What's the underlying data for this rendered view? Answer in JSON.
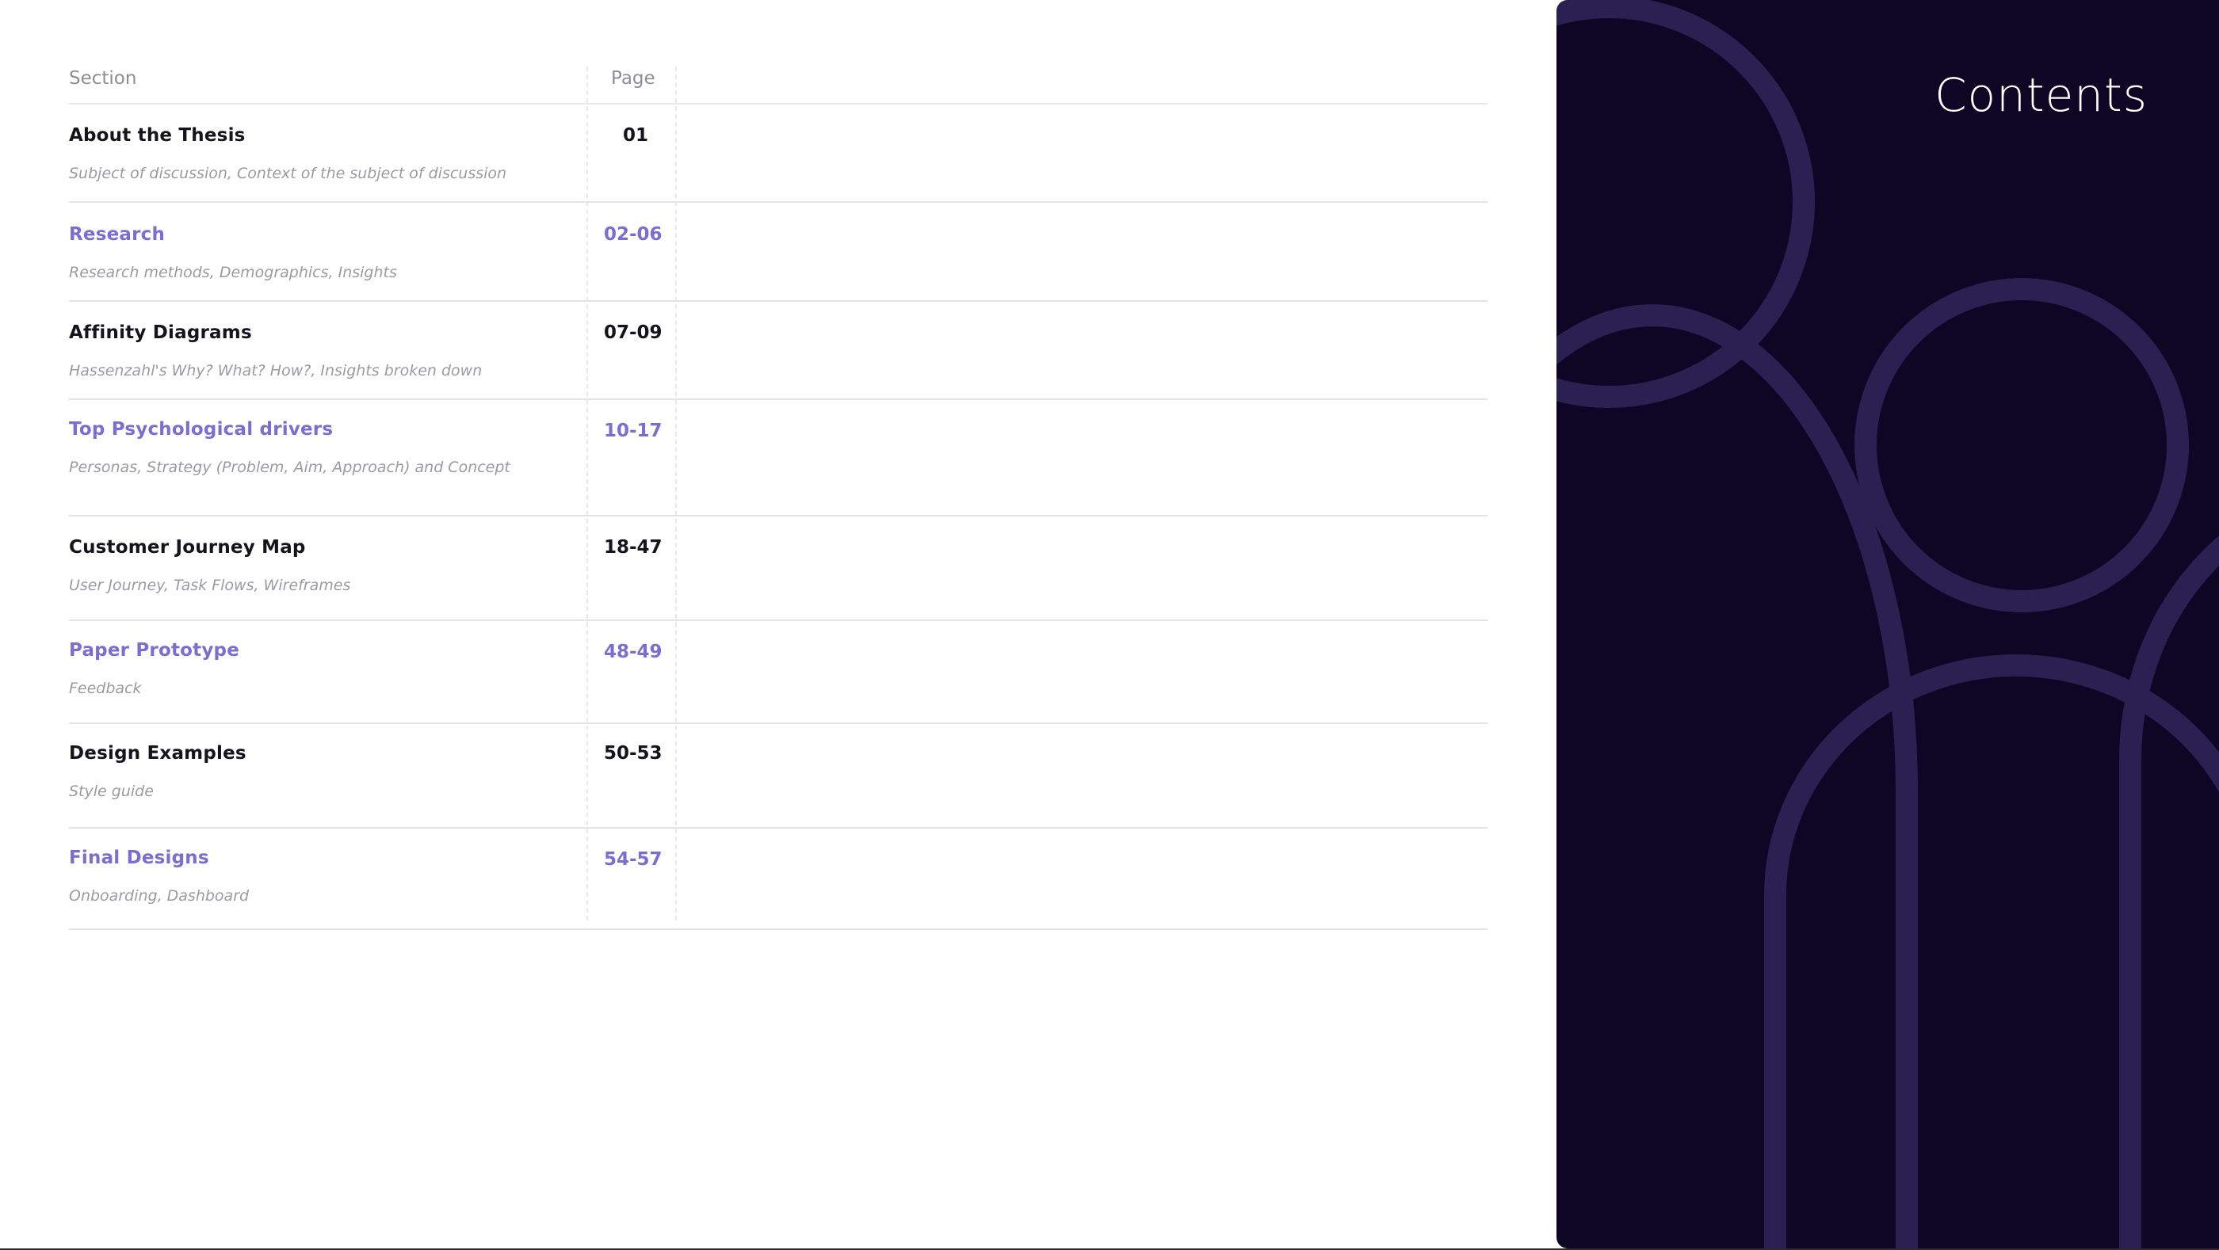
{
  "panel": {
    "title": "Contents"
  },
  "toc": {
    "headers": {
      "section": "Section",
      "page": "Page"
    },
    "rows": [
      {
        "title": "About the Thesis",
        "subtitle": "Subject of discussion, Context of the subject of discussion",
        "pages": "01"
      },
      {
        "title": "Research",
        "subtitle": "Research methods, Demographics, Insights",
        "pages": "02-06"
      },
      {
        "title": "Affinity Diagrams",
        "subtitle": "Hassenzahl's Why? What? How?, Insights broken down",
        "pages": "07-09"
      },
      {
        "title": "Top Psychological drivers",
        "subtitle": "Personas, Strategy (Problem, Aim, Approach) and Concept",
        "pages": "10-17"
      },
      {
        "title": "Customer Journey Map",
        "subtitle": "User Journey, Task Flows, Wireframes",
        "pages": "18-47"
      },
      {
        "title": "Paper Prototype",
        "subtitle": "Feedback",
        "pages": "48-49"
      },
      {
        "title": "Design Examples",
        "subtitle": "Style guide",
        "pages": "50-53"
      },
      {
        "title": "Final Designs",
        "subtitle": "Onboarding, Dashboard",
        "pages": "54-57"
      }
    ]
  },
  "colors": {
    "panel_background": "#0e0624",
    "decor_stroke": "#2a2152",
    "accent_text": "#7a6ed1",
    "primary_text": "#15141d",
    "muted_text": "#9a9aa2"
  }
}
